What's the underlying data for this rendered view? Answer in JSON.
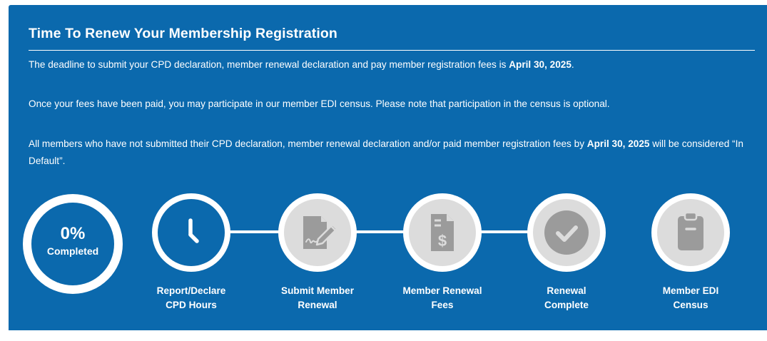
{
  "header": {
    "title": "Time To Renew Your Membership Registration"
  },
  "paragraphs": {
    "p1_text": "The deadline to submit your CPD declaration, member renewal declaration and pay member registration fees is ",
    "p1_date": "April 30, 2025",
    "p1_end": ".",
    "p2_text": "Once your fees have been paid, you may participate in our member EDI census. Please note that participation in the census is optional.",
    "p3_text": "All members who have not submitted their CPD declaration, member renewal declaration and/or paid member registration fees by ",
    "p3_date": "April 30, 2025",
    "p3_end": " will be considered “In Default”."
  },
  "progress": {
    "percent_label": "0%",
    "completed_label": "Completed",
    "percent_value": 0
  },
  "steps": [
    {
      "label": "Report/Declare CPD Hours",
      "icon": "clock-icon",
      "active": true
    },
    {
      "label": "Submit Member Renewal",
      "icon": "signed-document-icon",
      "active": false
    },
    {
      "label": "Member Renewal Fees",
      "icon": "invoice-dollar-icon",
      "active": false
    },
    {
      "label": "Renewal Complete",
      "icon": "checkmark-circle-icon",
      "active": false
    },
    {
      "label": "Member EDI Census",
      "icon": "clipboard-icon",
      "active": false
    }
  ],
  "colors": {
    "panel_background": "#0b69ad",
    "inactive_circle": "#dcdcdc",
    "inactive_icon": "#9b9b9b",
    "text": "#ffffff"
  }
}
